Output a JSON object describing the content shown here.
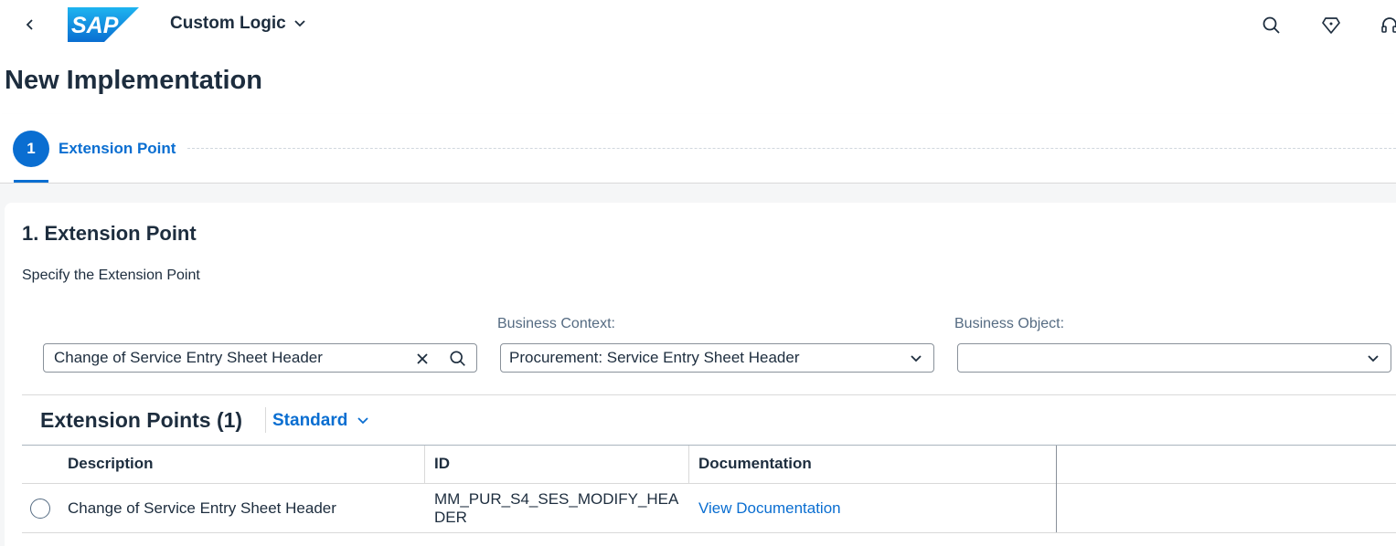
{
  "shell": {
    "logo_text": "SAP",
    "app_title": "Custom Logic",
    "icons": [
      "search-icon",
      "diamond-icon",
      "headset-icon"
    ]
  },
  "page": {
    "title": "New Implementation"
  },
  "wizard": {
    "step_number": "1",
    "step_label": "Extension Point"
  },
  "section": {
    "title": "1. Extension Point",
    "description": "Specify the Extension Point"
  },
  "filters": {
    "search_value": "Change of Service Entry Sheet Header",
    "business_context_label": "Business Context:",
    "business_context_value": "Procurement: Service Entry Sheet Header",
    "business_object_label": "Business Object:",
    "business_object_value": ""
  },
  "table": {
    "title": "Extension Points (1)",
    "variant": "Standard",
    "columns": {
      "description": "Description",
      "id": "ID",
      "documentation": "Documentation"
    },
    "rows": [
      {
        "description": "Change of Service Entry Sheet Header",
        "id_line1": "MM_PUR_S4_SES_MODIFY_HEA",
        "id_line2": "DER",
        "documentation": "View Documentation"
      }
    ]
  },
  "colors": {
    "accent": "#0a6ed1",
    "text": "#1d2d3e",
    "label": "#556b82"
  }
}
